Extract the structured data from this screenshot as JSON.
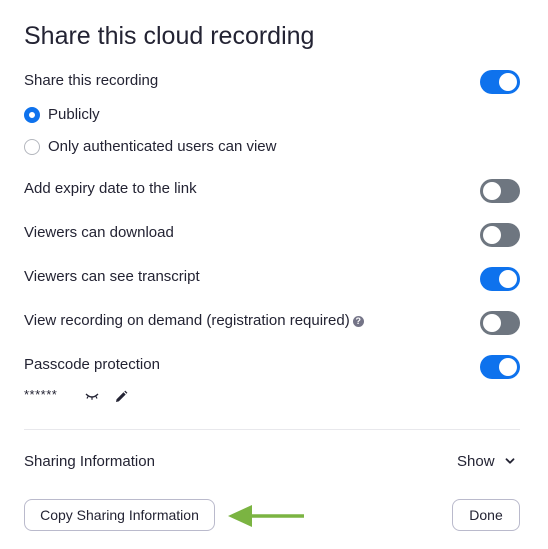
{
  "title": "Share this cloud recording",
  "share_recording": {
    "label": "Share this recording",
    "enabled": true
  },
  "visibility": {
    "options": [
      {
        "label": "Publicly",
        "checked": true
      },
      {
        "label": "Only authenticated users can view",
        "checked": false
      }
    ]
  },
  "settings": [
    {
      "label": "Add expiry date to the link",
      "enabled": false
    },
    {
      "label": "Viewers can download",
      "enabled": false
    },
    {
      "label": "Viewers can see transcript",
      "enabled": true
    },
    {
      "label": "View recording on demand (registration required)",
      "enabled": false,
      "help_icon": "question-circle-icon"
    },
    {
      "label": "Passcode protection",
      "enabled": true
    }
  ],
  "passcode": {
    "masked_value": "******",
    "reveal_icon": "eye-closed-icon",
    "edit_icon": "pencil-icon"
  },
  "sharing_information": {
    "label": "Sharing Information",
    "toggle_label": "Show",
    "toggle_icon": "chevron-down-icon"
  },
  "footer": {
    "copy_label": "Copy Sharing Information",
    "done_label": "Done"
  },
  "annotation": {
    "arrow_color": "#7bb442"
  },
  "colors": {
    "accent": "#0e72ed",
    "toggle_off": "#6e7680",
    "text": "#232333"
  }
}
